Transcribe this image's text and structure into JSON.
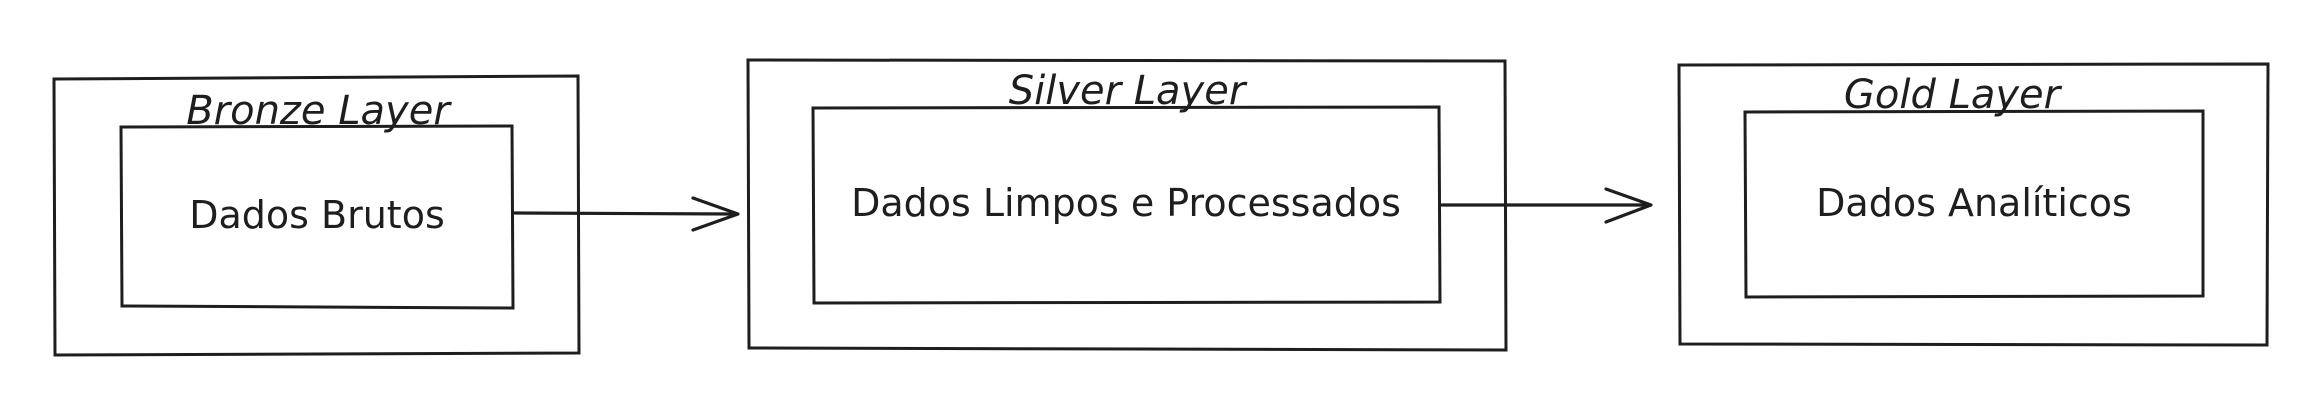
{
  "layers": [
    {
      "id": "bronze",
      "title": "Bronze Layer",
      "content": "Dados Brutos"
    },
    {
      "id": "silver",
      "title": "Silver Layer",
      "content": "Dados Limpos e Processados"
    },
    {
      "id": "gold",
      "title": "Gold Layer",
      "content": "Dados Analíticos"
    }
  ],
  "colors": {
    "stroke": "#1e1e1e",
    "background": "#ffffff",
    "text": "#1e1e1e"
  }
}
